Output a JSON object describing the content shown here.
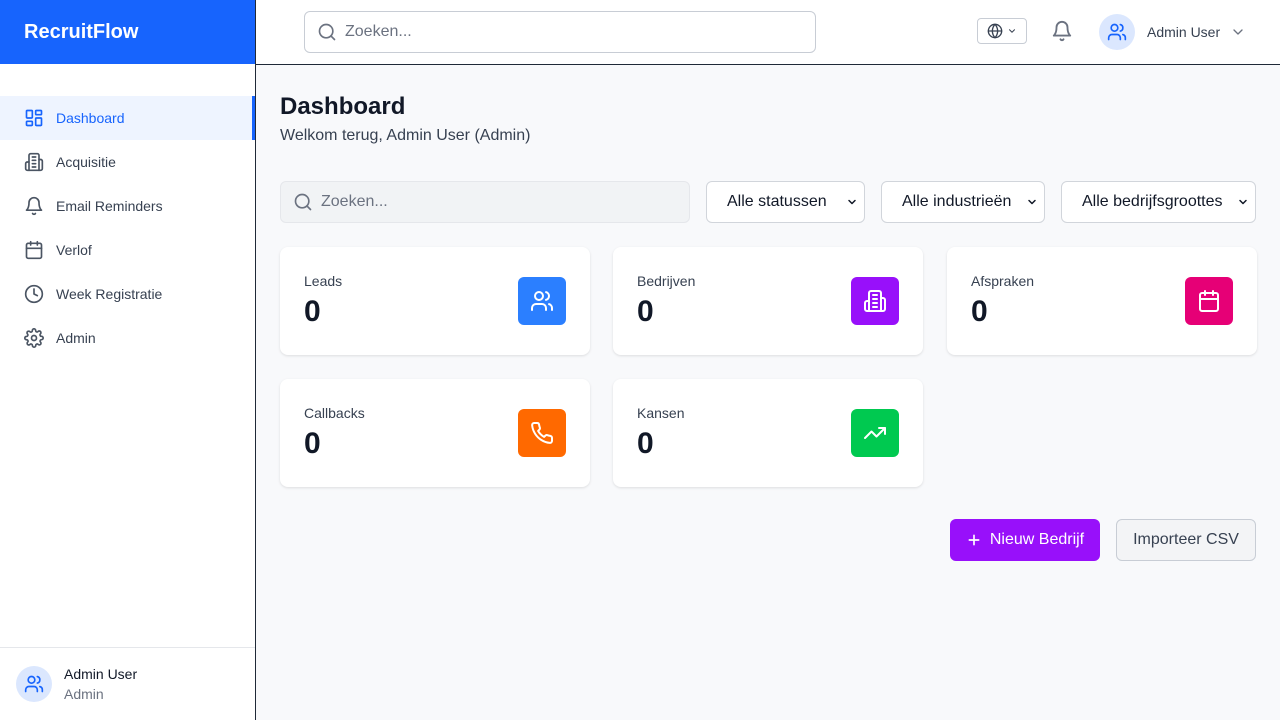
{
  "app": {
    "brand": "RecruitFlow"
  },
  "sidebar": {
    "items": [
      {
        "label": "Dashboard",
        "icon": "dashboard-grid-icon",
        "active": true
      },
      {
        "label": "Acquisitie",
        "icon": "building-icon"
      },
      {
        "label": "Email Reminders",
        "icon": "bell-icon"
      },
      {
        "label": "Verlof",
        "icon": "calendar-icon"
      },
      {
        "label": "Week Registratie",
        "icon": "clock-icon"
      },
      {
        "label": "Admin",
        "icon": "gear-icon"
      }
    ],
    "footer": {
      "name": "Admin User",
      "role": "Admin"
    }
  },
  "header": {
    "search_placeholder": "Zoeken...",
    "user_name": "Admin User"
  },
  "main": {
    "title": "Dashboard",
    "subtitle": "Welkom terug, Admin User (Admin)",
    "filters": {
      "search_placeholder": "Zoeken...",
      "status": "Alle statussen",
      "industry": "Alle industrieën",
      "size": "Alle bedrijfsgroottes"
    },
    "cards": [
      {
        "label": "Leads",
        "value": "0",
        "icon": "users-icon",
        "color": "#2b7fff"
      },
      {
        "label": "Bedrijven",
        "value": "0",
        "icon": "building-icon",
        "color": "#9810fa"
      },
      {
        "label": "Afspraken",
        "value": "0",
        "icon": "calendar-icon",
        "color": "#e60076"
      },
      {
        "label": "Callbacks",
        "value": "0",
        "icon": "phone-icon",
        "color": "#ff6900"
      },
      {
        "label": "Kansen",
        "value": "0",
        "icon": "trending-up-icon",
        "color": "#00c950"
      }
    ],
    "actions": {
      "new_company": "Nieuw Bedrijf",
      "import_csv": "Importeer CSV"
    }
  },
  "colors": {
    "brand": "#1764fd",
    "primary_button": "#9810fa"
  }
}
